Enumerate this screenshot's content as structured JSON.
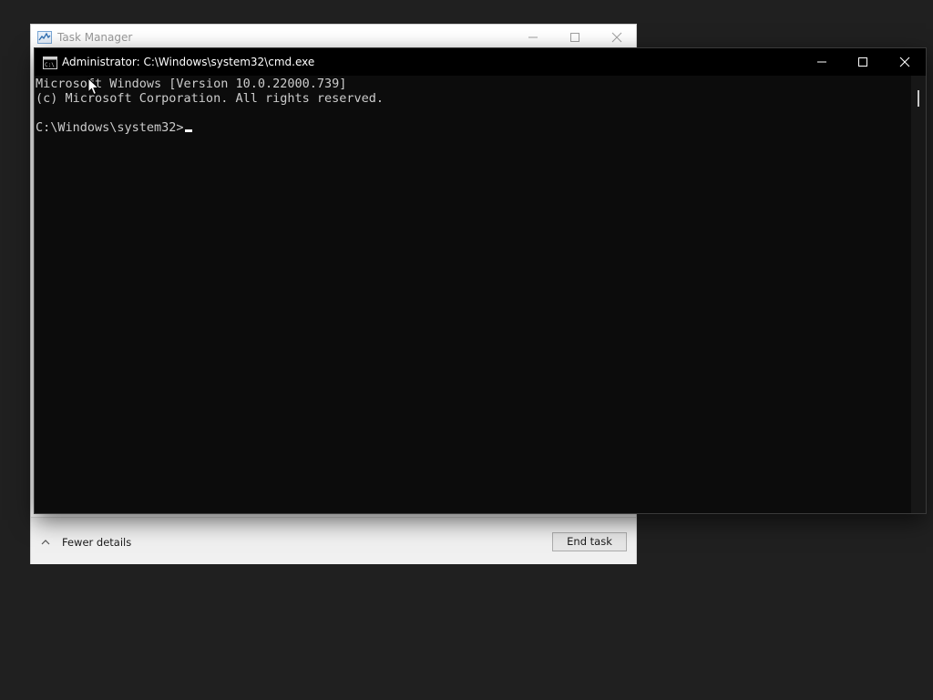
{
  "task_manager": {
    "title": "Task Manager",
    "fewer_details_label": "Fewer details",
    "end_task_label": "End task",
    "icons": {
      "app": "task-manager-icon",
      "fewer_details": "chevron-up-icon"
    }
  },
  "cmd": {
    "title": "Administrator: C:\\Windows\\system32\\cmd.exe",
    "lines": [
      "Microsoft Windows [Version 10.0.22000.739]",
      "(c) Microsoft Corporation. All rights reserved.",
      "C:\\Windows\\system32>"
    ],
    "icons": {
      "app": "cmd-icon",
      "minimize": "minimize-icon",
      "maximize": "maximize-icon",
      "close": "close-icon"
    }
  },
  "colors": {
    "desktop": "#202020",
    "console_bg": "#0c0c0c",
    "console_text": "#cccccc",
    "titlebar": "#000000"
  }
}
